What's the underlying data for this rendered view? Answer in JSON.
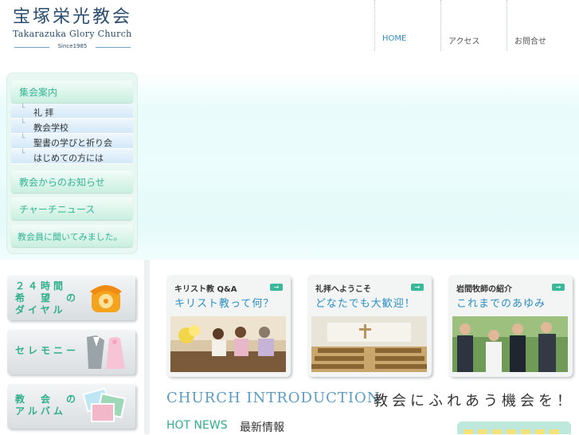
{
  "logo": {
    "jp": "宝塚栄光教会",
    "en": "Takarazuka Glory Church",
    "since": "Since1985"
  },
  "topnav": [
    {
      "label": "HOME"
    },
    {
      "label": "アクセス"
    },
    {
      "label": "お問合せ"
    }
  ],
  "sidebar": {
    "group_worship": "集会案内",
    "sub": [
      {
        "label": "礼 拝"
      },
      {
        "label": "教会学校"
      },
      {
        "label": "聖書の学びと祈り会"
      },
      {
        "label": "はじめての方には"
      }
    ],
    "notice": "教会からのお知らせ",
    "news": "チャーチニュース",
    "ask": "教会員に聞いてみました。"
  },
  "left_buttons": [
    {
      "label": "２４時間\n希　望　の\nダイヤル",
      "icon": "telephone-icon"
    },
    {
      "label": "セレモニー",
      "icon": "wedding-attire-icon"
    },
    {
      "label": "教　会　の\nアルバム",
      "icon": "photo-album-icon"
    }
  ],
  "cards": [
    {
      "t1": "キリスト教 Q&A",
      "t2": "キリスト教って何？"
    },
    {
      "t1": "礼拝へようこそ",
      "t2": "どなたでも大歓迎！"
    },
    {
      "t1": "岩間牧師の紹介",
      "t2": "これまでのあゆみ"
    }
  ],
  "intro": {
    "en": "CHURCH INTRODUCTION",
    "jp": "教会にふれあう機会を！"
  },
  "hot": {
    "en": "HOT NEWS",
    "jp": "最新情報"
  }
}
